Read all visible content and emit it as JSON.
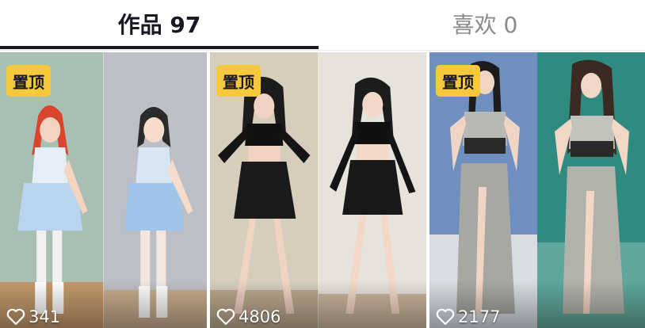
{
  "tabs": {
    "works_label": "作品 97",
    "likes_label": "喜欢 0"
  },
  "colors": {
    "pin_badge": "#f5c93b",
    "active_text": "#161823",
    "inactive_text": "#8a8a8a"
  },
  "videos": [
    {
      "pin_label": "置顶",
      "likes": "341",
      "icon": "heart-outline-icon"
    },
    {
      "pin_label": "置顶",
      "likes": "4806",
      "icon": "heart-outline-icon"
    },
    {
      "pin_label": "置顶",
      "likes": "2177",
      "icon": "heart-outline-icon"
    }
  ]
}
